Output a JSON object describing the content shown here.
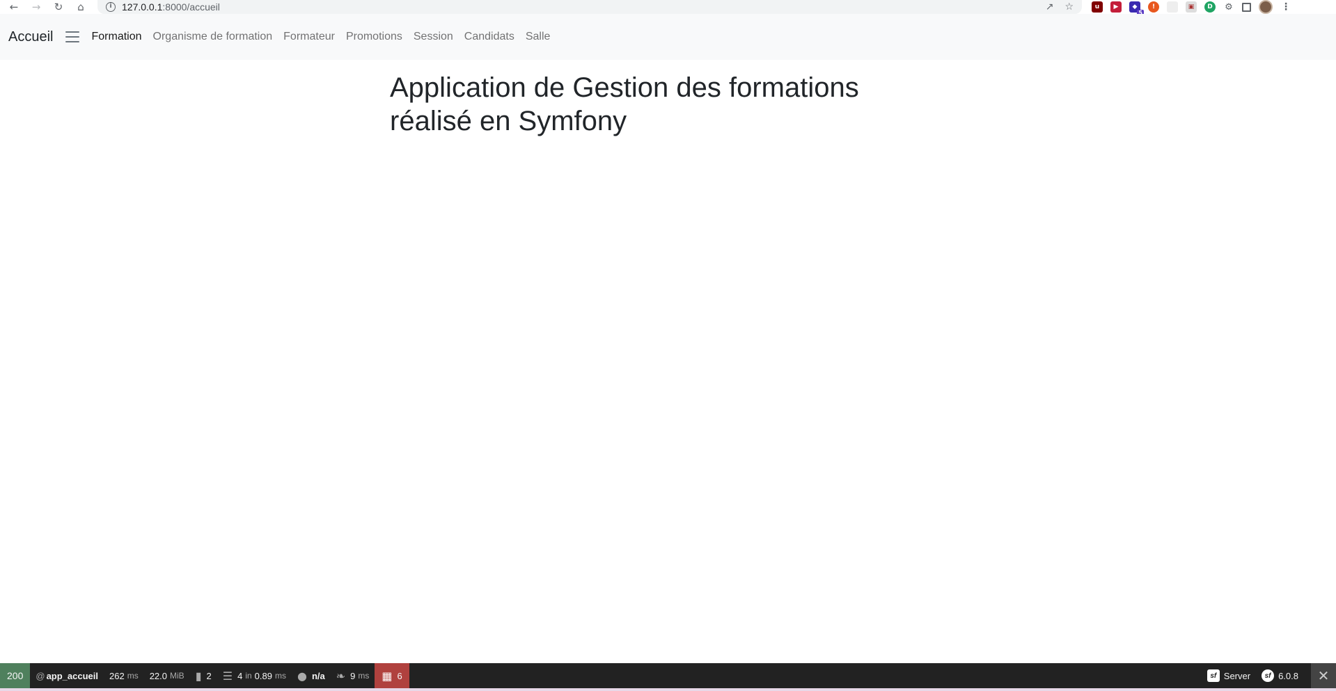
{
  "browser": {
    "url_host": "127.0.0.1",
    "url_rest": ":8000/accueil",
    "icons": [
      "back-icon",
      "forward-icon",
      "reload-icon",
      "home-icon",
      "info-icon",
      "share-icon",
      "star-icon",
      "extensions-icon",
      "side-panel-icon",
      "menu-icon"
    ],
    "extension_badge": "5"
  },
  "navbar": {
    "brand": "Accueil",
    "links": [
      {
        "label": "Formation",
        "active": true
      },
      {
        "label": "Organisme de formation"
      },
      {
        "label": "Formateur"
      },
      {
        "label": "Promotions"
      },
      {
        "label": "Session"
      },
      {
        "label": "Candidats"
      },
      {
        "label": "Salle"
      }
    ]
  },
  "main": {
    "heading": "Application de Gestion des formations réalisé en Symfony"
  },
  "toolbar": {
    "status_code": "200",
    "route_prefix": "@",
    "route": "app_accueil",
    "time_value": "262",
    "time_unit": "ms",
    "memory_value": "22.0",
    "memory_unit": "MiB",
    "logs_count": "2",
    "cache_calls": "4",
    "cache_in": "in",
    "cache_time": "0.89",
    "cache_unit": "ms",
    "user": "n/a",
    "twig_time": "9",
    "twig_unit": "ms",
    "errors_count": "6",
    "server_label": "Server",
    "symfony_version": "6.0.8",
    "colors": {
      "status_ok": "#4f805d",
      "error": "#b0413e",
      "bg": "#222222"
    }
  }
}
